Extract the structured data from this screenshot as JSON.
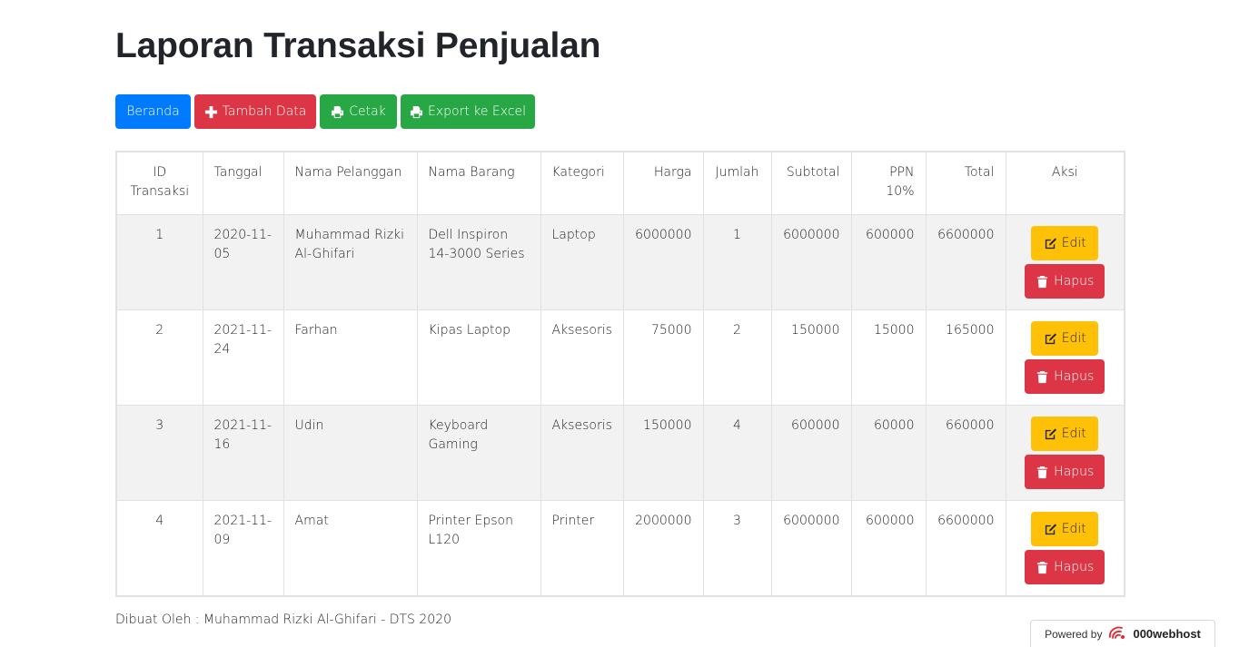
{
  "page": {
    "title": "Laporan Transaksi Penjualan",
    "footer": "Dibuat Oleh : Muhammad Rizki Al-Ghifari - DTS 2020"
  },
  "toolbar": {
    "home_label": "Beranda",
    "add_label": "Tambah Data",
    "print_label": "Cetak",
    "export_label": "Export ke Excel"
  },
  "table": {
    "headers": [
      "ID Transaksi",
      "Tanggal",
      "Nama Pelanggan",
      "Nama Barang",
      "Kategori",
      "Harga",
      "Jumlah",
      "Subtotal",
      "PPN 10%",
      "Total",
      "Aksi"
    ],
    "rows": [
      {
        "id": "1",
        "tanggal": "2020-11-05",
        "pelanggan": "Muhammad Rizki Al-Ghifari",
        "barang": "Dell Inspiron 14-3000 Series",
        "kategori": "Laptop",
        "harga": "6000000",
        "jumlah": "1",
        "subtotal": "6000000",
        "ppn": "600000",
        "total": "6600000"
      },
      {
        "id": "2",
        "tanggal": "2021-11-24",
        "pelanggan": "Farhan",
        "barang": "Kipas Laptop",
        "kategori": "Aksesoris",
        "harga": "75000",
        "jumlah": "2",
        "subtotal": "150000",
        "ppn": "15000",
        "total": "165000"
      },
      {
        "id": "3",
        "tanggal": "2021-11-16",
        "pelanggan": "Udin",
        "barang": "Keyboard Gaming",
        "kategori": "Aksesoris",
        "harga": "150000",
        "jumlah": "4",
        "subtotal": "600000",
        "ppn": "60000",
        "total": "660000"
      },
      {
        "id": "4",
        "tanggal": "2021-11-09",
        "pelanggan": "Amat",
        "barang": "Printer Epson L120",
        "kategori": "Printer",
        "harga": "2000000",
        "jumlah": "3",
        "subtotal": "6000000",
        "ppn": "600000",
        "total": "6600000"
      }
    ],
    "edit_label": "Edit",
    "delete_label": "Hapus"
  },
  "badge": {
    "powered_label": "Powered by",
    "brand": "000webhost"
  },
  "colors": {
    "primary": "#007bff",
    "danger": "#dc3545",
    "success": "#28a745",
    "warning": "#ffc107",
    "stripe": "#f2f2f2"
  },
  "icons": {
    "add": "plus-icon",
    "print": "print-icon",
    "export": "print-icon",
    "edit": "edit-icon",
    "delete": "trash-icon",
    "badge": "webhost-logo-icon"
  }
}
